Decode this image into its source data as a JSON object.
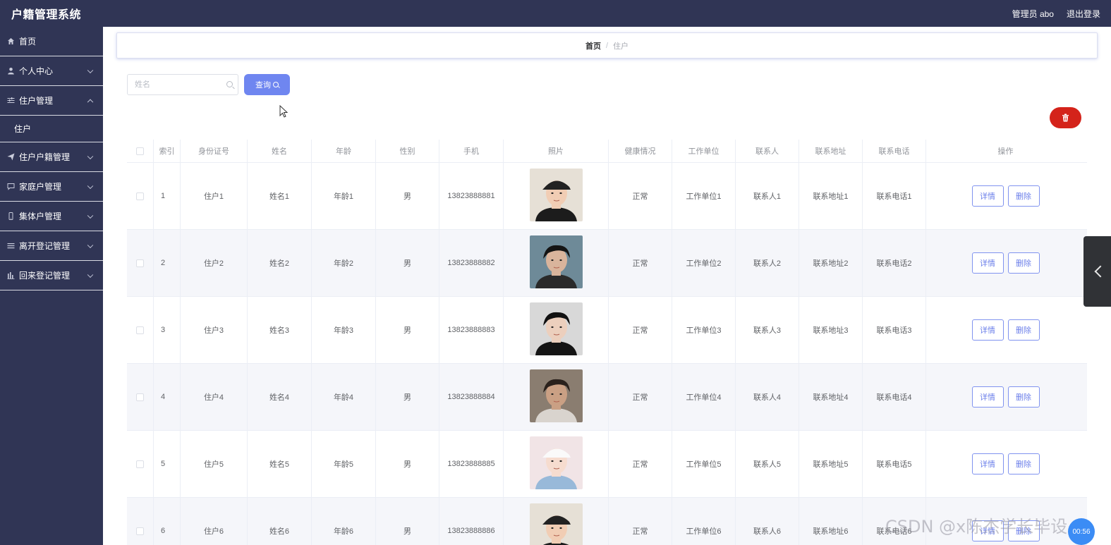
{
  "app": {
    "title": "户籍管理系统"
  },
  "header": {
    "user_label": "管理员 abo",
    "logout_label": "退出登录"
  },
  "sidebar": {
    "items": [
      {
        "label": "首页",
        "icon": "home-icon",
        "expandable": false
      },
      {
        "label": "个人中心",
        "icon": "user-icon",
        "expandable": true,
        "expanded": false
      },
      {
        "label": "住户管理",
        "icon": "sliders-icon",
        "expandable": true,
        "expanded": true,
        "children": [
          "住户"
        ]
      },
      {
        "label": "住户户籍管理",
        "icon": "send-icon",
        "expandable": true,
        "expanded": false
      },
      {
        "label": "家庭户管理",
        "icon": "chat-icon",
        "expandable": true,
        "expanded": false
      },
      {
        "label": "集体户管理",
        "icon": "phone-icon",
        "expandable": true,
        "expanded": false
      },
      {
        "label": "离开登记管理",
        "icon": "list-icon",
        "expandable": true,
        "expanded": false
      },
      {
        "label": "回来登记管理",
        "icon": "chart-icon",
        "expandable": true,
        "expanded": false
      }
    ]
  },
  "breadcrumb": {
    "home": "首页",
    "separator": "/",
    "current": "住户"
  },
  "search": {
    "placeholder": "姓名",
    "value": "",
    "button_label": "查询"
  },
  "table": {
    "headers": [
      "",
      "索引",
      "身份证号",
      "姓名",
      "年龄",
      "性别",
      "手机",
      "照片",
      "健康情况",
      "工作单位",
      "联系人",
      "联系地址",
      "联系电话",
      "操作"
    ],
    "rows": [
      {
        "index": "1",
        "id_card": "住户1",
        "name": "姓名1",
        "age": "年龄1",
        "gender": "男",
        "phone": "13823888881",
        "health": "正常",
        "work_unit": "工作单位1",
        "contact": "联系人1",
        "address": "联系地址1",
        "contact_phone": "联系电话1"
      },
      {
        "index": "2",
        "id_card": "住户2",
        "name": "姓名2",
        "age": "年龄2",
        "gender": "男",
        "phone": "13823888882",
        "health": "正常",
        "work_unit": "工作单位2",
        "contact": "联系人2",
        "address": "联系地址2",
        "contact_phone": "联系电话2"
      },
      {
        "index": "3",
        "id_card": "住户3",
        "name": "姓名3",
        "age": "年龄3",
        "gender": "男",
        "phone": "13823888883",
        "health": "正常",
        "work_unit": "工作单位3",
        "contact": "联系人3",
        "address": "联系地址3",
        "contact_phone": "联系电话3"
      },
      {
        "index": "4",
        "id_card": "住户4",
        "name": "姓名4",
        "age": "年龄4",
        "gender": "男",
        "phone": "13823888884",
        "health": "正常",
        "work_unit": "工作单位4",
        "contact": "联系人4",
        "address": "联系地址4",
        "contact_phone": "联系电话4"
      },
      {
        "index": "5",
        "id_card": "住户5",
        "name": "姓名5",
        "age": "年龄5",
        "gender": "男",
        "phone": "13823888885",
        "health": "正常",
        "work_unit": "工作单位5",
        "contact": "联系人5",
        "address": "联系地址5",
        "contact_phone": "联系电话5"
      },
      {
        "index": "6",
        "id_card": "住户6",
        "name": "姓名6",
        "age": "年龄6",
        "gender": "男",
        "phone": "13823888886",
        "health": "正常",
        "work_unit": "工作单位6",
        "contact": "联系人6",
        "address": "联系地址6",
        "contact_phone": "联系电话6"
      }
    ],
    "detail_label": "详情",
    "delete_label": "删除"
  },
  "watermark": "CSDN @x陈杰学长毕设",
  "float_ball_label": "00:56",
  "colors": {
    "sidebar_bg": "#303555",
    "primary": "#6f86f0",
    "danger": "#d4231a"
  }
}
